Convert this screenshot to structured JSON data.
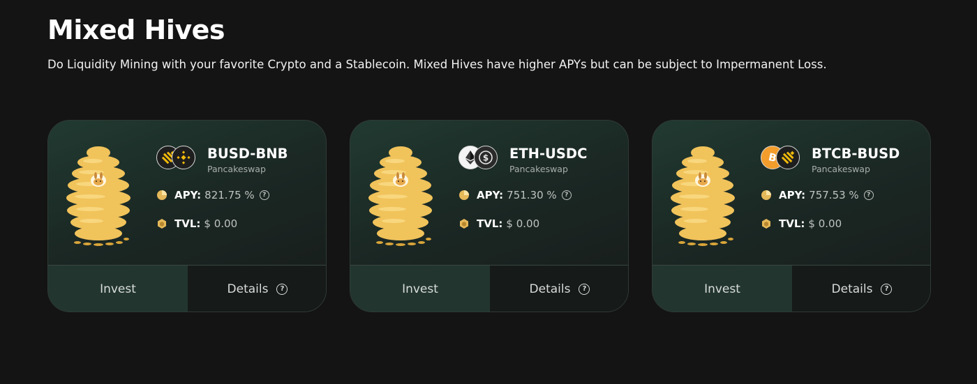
{
  "page": {
    "title": "Mixed Hives",
    "subtitle": "Do Liquidity Mining with your favorite Crypto and a Stablecoin. Mixed Hives have higher APYs but can be subject to Impermanent Loss."
  },
  "colors": {
    "background": "#141414",
    "card_gradient_start": "#213a31",
    "invest_bg": "#22362f",
    "details_bg": "#161a18",
    "honey": "#f2c35a"
  },
  "cards": [
    {
      "pair": "BUSD-BNB",
      "source": "Pancakeswap",
      "coins": [
        "busd-icon",
        "bnb-icon"
      ],
      "apy_label": "APY:",
      "apy_value": "821.75 %",
      "tvl_label": "TVL:",
      "tvl_value": "$ 0.00",
      "invest_label": "Invest",
      "details_label": "Details"
    },
    {
      "pair": "ETH-USDC",
      "source": "Pancakeswap",
      "coins": [
        "eth-icon",
        "usdc-icon"
      ],
      "apy_label": "APY:",
      "apy_value": "751.30 %",
      "tvl_label": "TVL:",
      "tvl_value": "$ 0.00",
      "invest_label": "Invest",
      "details_label": "Details"
    },
    {
      "pair": "BTCB-BUSD",
      "source": "Pancakeswap",
      "coins": [
        "btc-icon",
        "busd-icon"
      ],
      "apy_label": "APY:",
      "apy_value": "757.53 %",
      "tvl_label": "TVL:",
      "tvl_value": "$ 0.00",
      "invest_label": "Invest",
      "details_label": "Details"
    }
  ],
  "icons": {
    "apy": "pie-chart-icon",
    "tvl": "honeycomb-icon",
    "help": "question-circle-icon",
    "hive": "beehive-illustration"
  }
}
